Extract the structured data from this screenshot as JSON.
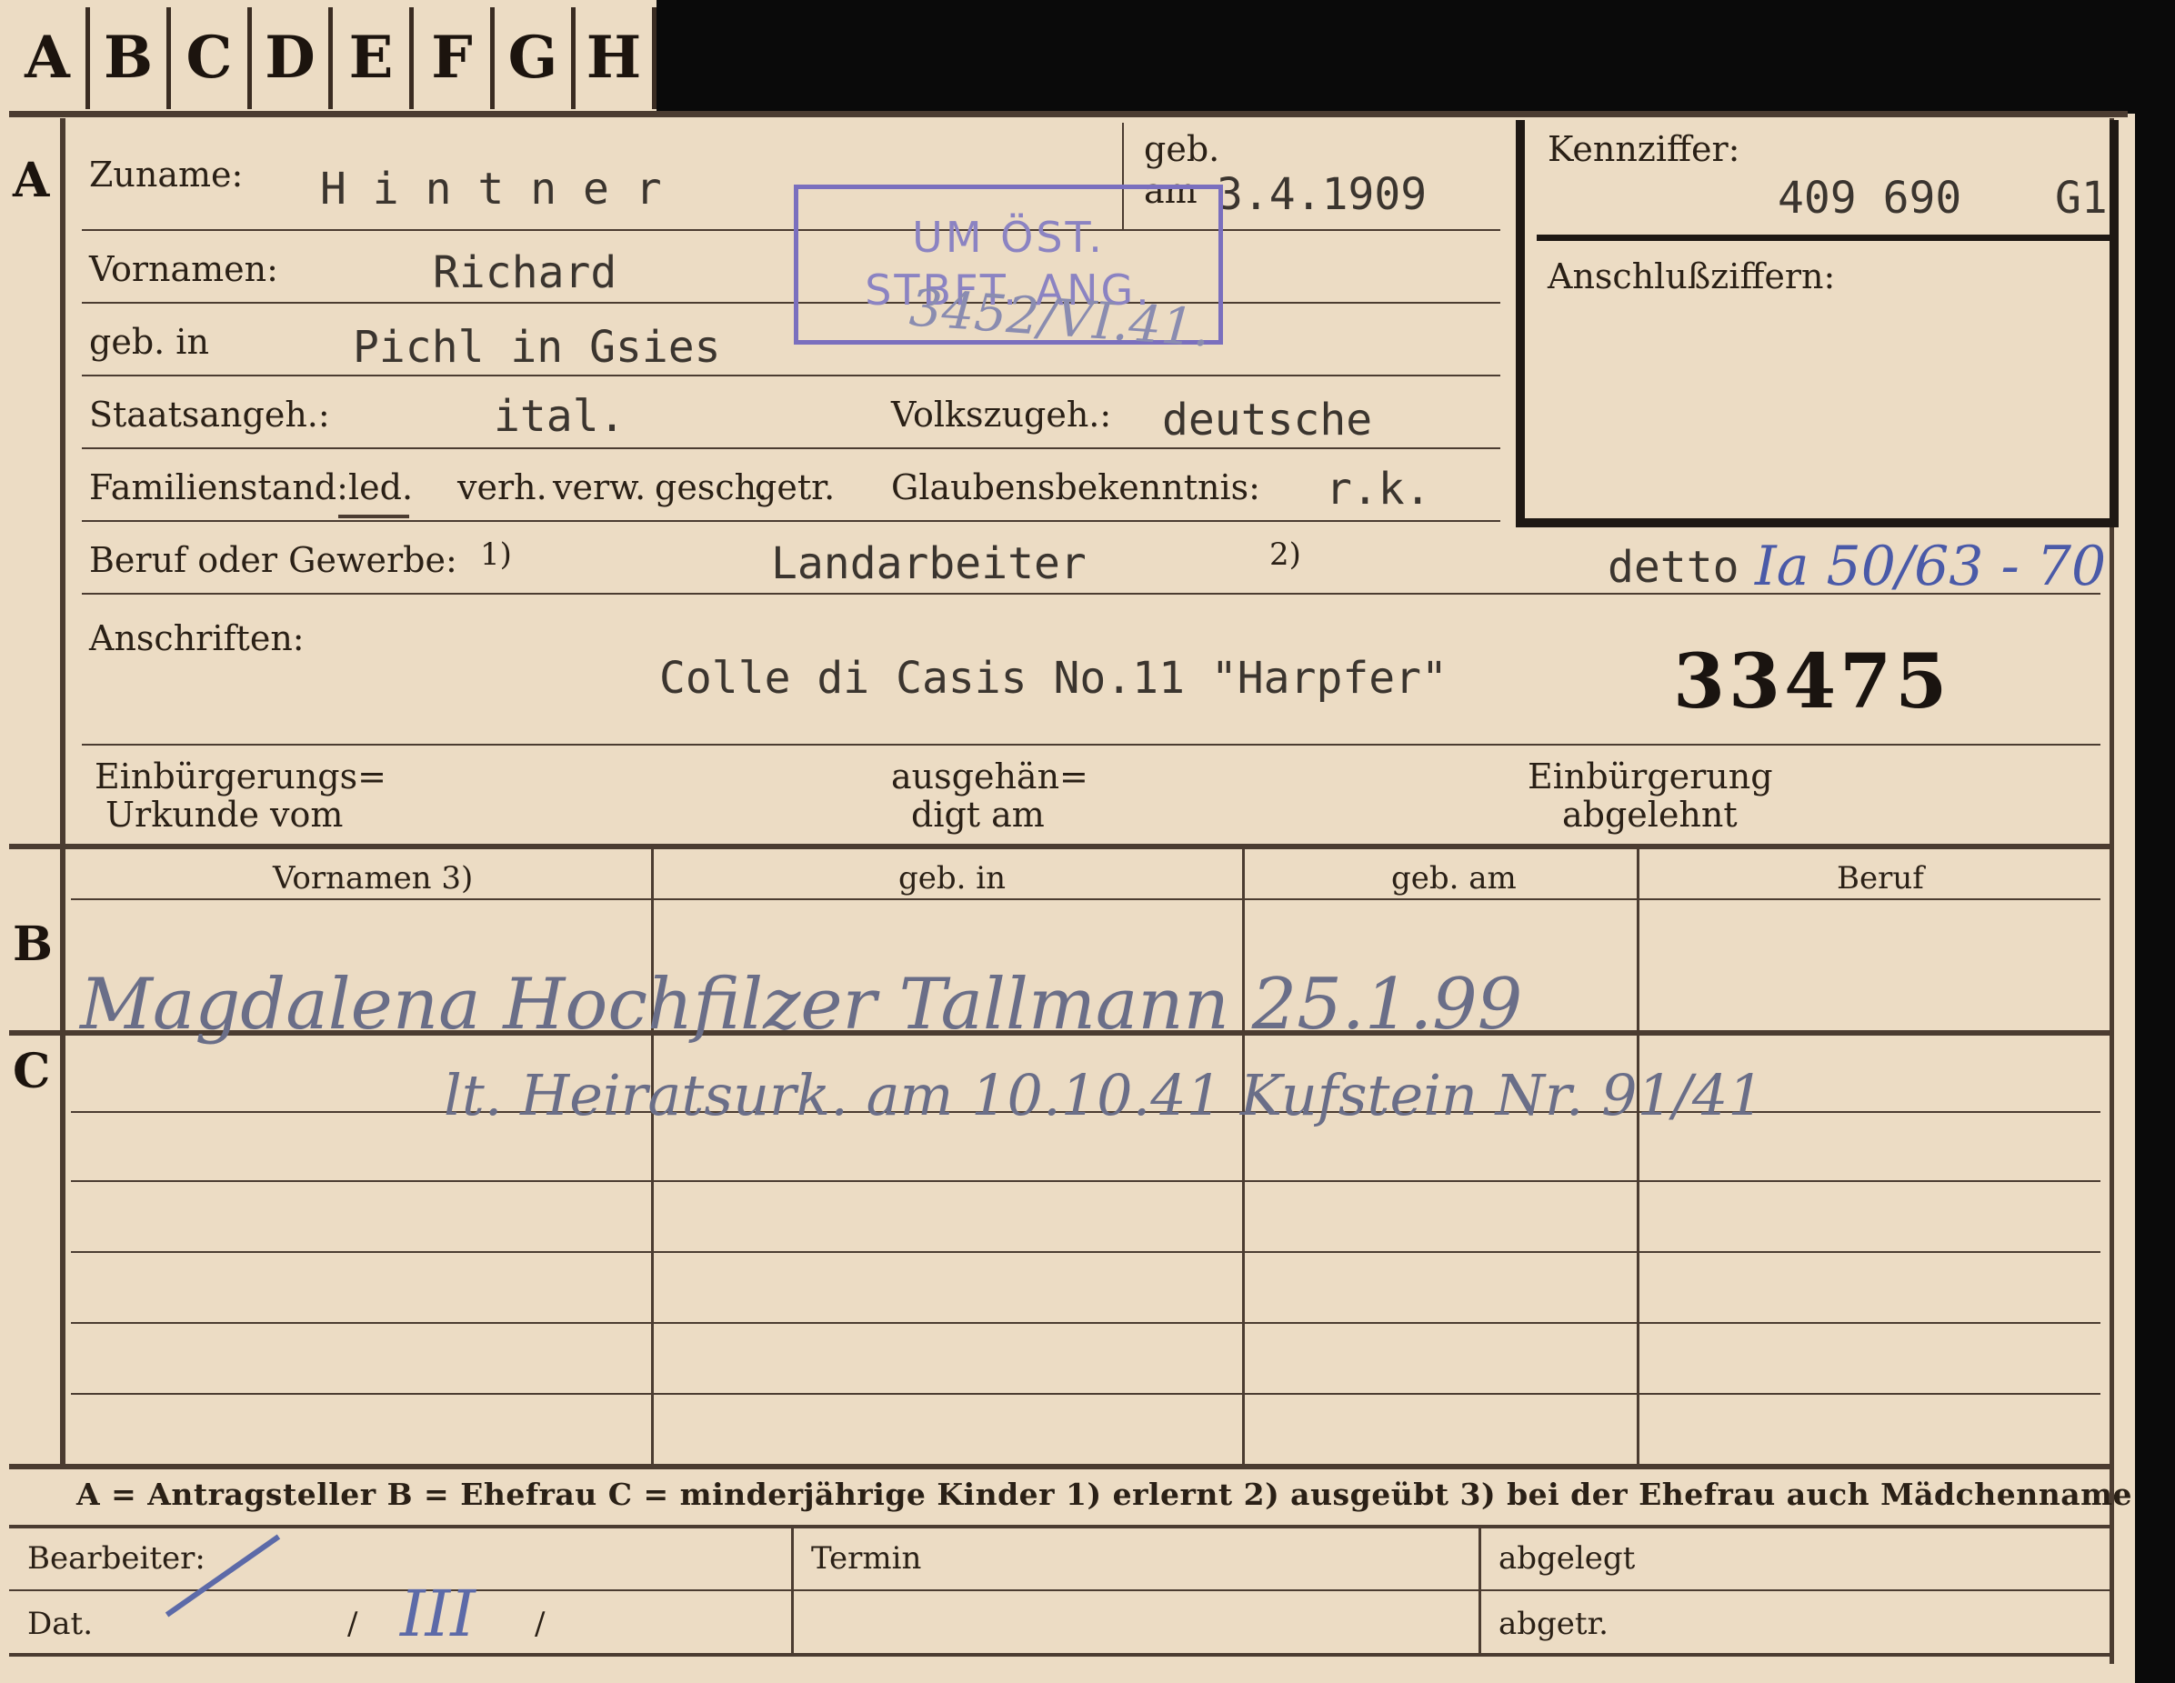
{
  "tabs": [
    "A",
    "B",
    "C",
    "D",
    "E",
    "F",
    "G",
    "H"
  ],
  "section_a": {
    "marker": "A",
    "zuname_label": "Zuname:",
    "zuname_value": "H i n t n e r",
    "geb_label": "geb.",
    "am_label": "am",
    "geb_am_value": "3.4.1909",
    "vornamen_label": "Vornamen:",
    "vornamen_value": "Richard",
    "geb_in_label": "geb. in",
    "geb_in_value": "Pichl in Gsies",
    "staatsangeh_label": "Staatsangeh.:",
    "staatsangeh_value": "ital.",
    "volkszugeh_label": "Volkszugeh.:",
    "volkszugeh_value": "deutsche",
    "familienstand_label": "Familienstand:",
    "familienstand_options": [
      "led.",
      "verh.",
      "verw.",
      "gesch.",
      "getr."
    ],
    "glaubens_label": "Glaubensbekenntnis:",
    "glaubens_value": "r.k.",
    "beruf_label": "Beruf oder Gewerbe:",
    "beruf_note1": "1)",
    "beruf_value": "Landarbeiter",
    "beruf_note2": "2)",
    "beruf_value2": "detto",
    "beruf_hand": "Ia 50/63 - 70",
    "anschriften_label": "Anschriften:",
    "anschriften_value": "Colle di Casis No.11 \"Harpfer\"",
    "big_number": "33475",
    "einb_urkunde_label_1": "Einbürgerungs=",
    "einb_urkunde_label_2": "Urkunde vom",
    "ausgehaen_label_1": "ausgehän=",
    "ausgehaen_label_2": "digt am",
    "einb_abgelehnt_1": "Einbürgerung",
    "einb_abgelehnt_2": "abgelehnt",
    "kennziffer_label": "Kennziffer:",
    "kennziffer_value": "409 690",
    "kennziffer_suffix": "G1",
    "anschluss_label": "Anschlußziffern:",
    "stamp_line1": "UM ÖST.",
    "stamp_line2": "STBFT. ANG.",
    "stamp_hand": "3452/VI.41."
  },
  "section_b": {
    "marker": "B",
    "headers": [
      "Vornamen 3)",
      "geb. in",
      "geb. am",
      "Beruf"
    ],
    "row_hand": "Magdalena Hochfilzer  Tallmann  25.1.99"
  },
  "section_c": {
    "marker": "C",
    "row_hand": "lt. Heiratsurk. am 10.10.41 Kufstein Nr. 91/41"
  },
  "legend": "A = Antragsteller   B = Ehefrau   C = minderjährige Kinder   1) erlernt   2) ausgeübt   3) bei der Ehefrau auch Mädchenname",
  "footer": {
    "bearbeiter_label": "Bearbeiter:",
    "dat_label": "Dat.",
    "dat_slash1": "/",
    "dat_hand": "III",
    "dat_slash2": "/",
    "termin_label": "Termin",
    "abgelegt_label": "abgelegt",
    "abgetr_label": "abgetr."
  },
  "colors": {
    "paper": "#ecdcc4",
    "ink": "#2a2016",
    "stamp": "#7a6fbe",
    "handwriting": "#6a6e88"
  }
}
